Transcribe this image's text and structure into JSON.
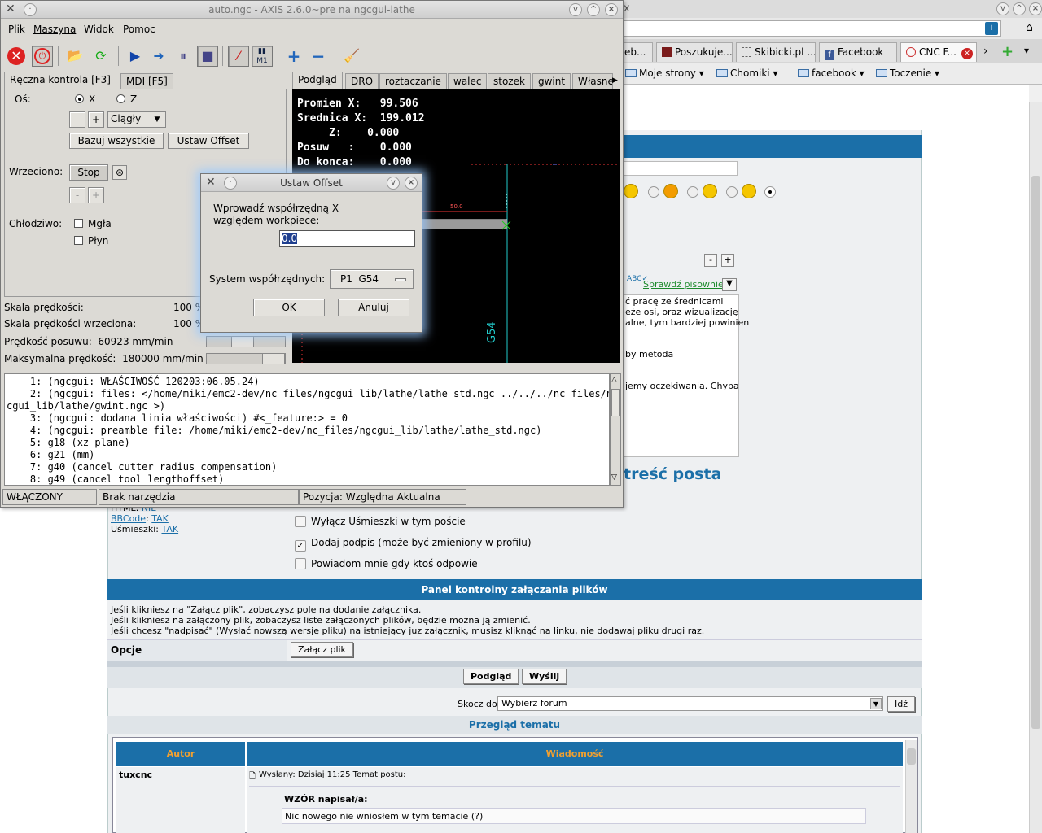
{
  "browser": {
    "tabs": [
      "eb...",
      "Poszukuje...",
      "Skibicki.pl ...",
      "Facebook",
      "CNC F..."
    ],
    "bookmarks": [
      "Moje strony",
      "Chomiki",
      "facebook",
      "Toczenie"
    ],
    "spell_check": "Sprawdź pisownie",
    "post_snippets": [
      "ć pracę ze średnicami",
      "eże osi, oraz wizualizację",
      "alne, tym bardziej powinien",
      "by metoda",
      "jemy oczekiwania. Chyba"
    ],
    "post_content_header": "treść posta",
    "html_label": "HTML:",
    "html_value": "NIE",
    "bbcode_label": "BBCode",
    "bbcode_value": "TAK",
    "smileys_label": "Uśmieszki:",
    "smileys_value": "TAK",
    "options": [
      {
        "label": "Wyłącz Uśmieszki w tym poście",
        "checked": false
      },
      {
        "label": "Dodaj podpis (może być zmieniony w profilu)",
        "checked": true
      },
      {
        "label": "Powiadom mnie gdy ktoś odpowie",
        "checked": false
      }
    ],
    "attach_header": "Panel kontrolny załączania plików",
    "attach_lines": [
      "Jeśli klikniesz na \"Załącz plik\", zobaczysz pole na dodanie załącznika.",
      "Jeśli klikniesz na załączony plik, zobaczysz liste załączonych plików, będzie można ją zmienić.",
      "Jeśli chcesz \"nadpisać\" (Wysłać nowszą wersję pliku) na istniejący juz załącznik, musisz kliknąć na linku, nie dodawaj pliku drugi raz."
    ],
    "options_label": "Opcje",
    "attach_button": "Załącz plik",
    "preview_button": "Podgląd",
    "send_button": "Wyślij",
    "jump_label": "Skocz do:",
    "jump_select": "Wybierz forum",
    "go_button": "Idź",
    "topic_review": "Przegląd tematu",
    "col_author": "Autor",
    "col_message": "Wiadomość",
    "post_author": "tuxcnc",
    "post_meta": "Wysłany: Dzisiaj 11:25    Temat postu:",
    "quote_author": "WZÓR napisał/a:",
    "quote_text": "Nic nowego nie wniosłem w tym temacie (?)",
    "minus": "-",
    "plus": "+",
    "colors": {
      "bar": "#1b6fa8",
      "title_text": "#1b6fa8"
    }
  },
  "axis": {
    "title": "auto.ngc - AXIS 2.6.0~pre na ngcgui-lathe",
    "menus": [
      "Plik",
      "Maszyna",
      "Widok",
      "Pomoc"
    ],
    "left_tabs": [
      "Ręczna kontrola [F3]",
      "MDI [F5]"
    ],
    "axis_label": "Oś:",
    "axis_x": "X",
    "axis_z": "Z",
    "selected_axis": "X",
    "jog_minus": "-",
    "jog_plus": "+",
    "jog_mode": "Ciągły",
    "home_all": "Bazuj wszystkie",
    "set_offset": "Ustaw Offset",
    "spindle_label": "Wrzeciono:",
    "spindle_stop": "Stop",
    "coolant_label": "Chłodziwo:",
    "mist": "Mgła",
    "flood": "Płyn",
    "feed_scale_label": "Skala prędkości:",
    "feed_scale_value": "100 %",
    "spindle_scale_label": "Skala prędkości wrzeciona:",
    "spindle_scale_value": "100 %",
    "feed_speed_label": "Prędkość posuwu:",
    "feed_speed_value": "60923 mm/min",
    "max_speed_label": "Maksymalna prędkość:",
    "max_speed_value": "180000 mm/min",
    "right_tabs": [
      "Podgląd",
      "DRO",
      "roztaczanie",
      "walec",
      "stozek",
      "gwint",
      "Własne"
    ],
    "dro": [
      "Promien X:   99.506",
      "Srednica X:  199.012",
      "     Z:    0.000",
      "Posuw   :    0.000",
      "Do konca:    0.000"
    ],
    "preview_dim": "50.0",
    "preview_g54": "G54",
    "gcode": [
      "    1: (ngcgui: WŁAŚCIWOŚĆ 120203:06.05.24)",
      "    2: (ngcgui: files: </home/miki/emc2-dev/nc_files/ngcgui_lib/lathe/lathe_std.ngc ../../../nc_files/ng",
      "cgui_lib/lathe/gwint.ngc >)",
      "    3: (ngcgui: dodana linia właściwości) #<_feature:> = 0",
      "    4: (ngcgui: preamble file: /home/miki/emc2-dev/nc_files/ngcgui_lib/lathe/lathe_std.ngc)",
      "    5: g18 (xz plane)",
      "    6: g21 (mm)",
      "    7: g40 (cancel cutter radius compensation)",
      "    8: g49 (cancel tool lengthoffset)"
    ],
    "status_machine": "WŁĄCZONY",
    "status_tool": "Brak narzędzia",
    "status_position": "Pozycja: Względna Aktualna",
    "toolbar_icons": [
      "estop-icon",
      "power-icon",
      "open-file-icon",
      "reload-icon",
      "run-icon",
      "step-icon",
      "pause-icon",
      "stop-icon",
      "block-delete-icon",
      "optional-stop-icon",
      "zoom-in-icon",
      "zoom-out-icon",
      "clear-plot-icon"
    ],
    "m1_label": "M1"
  },
  "dialog": {
    "title": "Ustaw Offset",
    "prompt_line1": "Wprowadź współrzędną X",
    "prompt_line2": "względem workpiece:",
    "value": "0.0",
    "coord_label": "System współrzędnych:",
    "coord_value": "P1  G54",
    "ok": "OK",
    "cancel": "Anuluj"
  }
}
